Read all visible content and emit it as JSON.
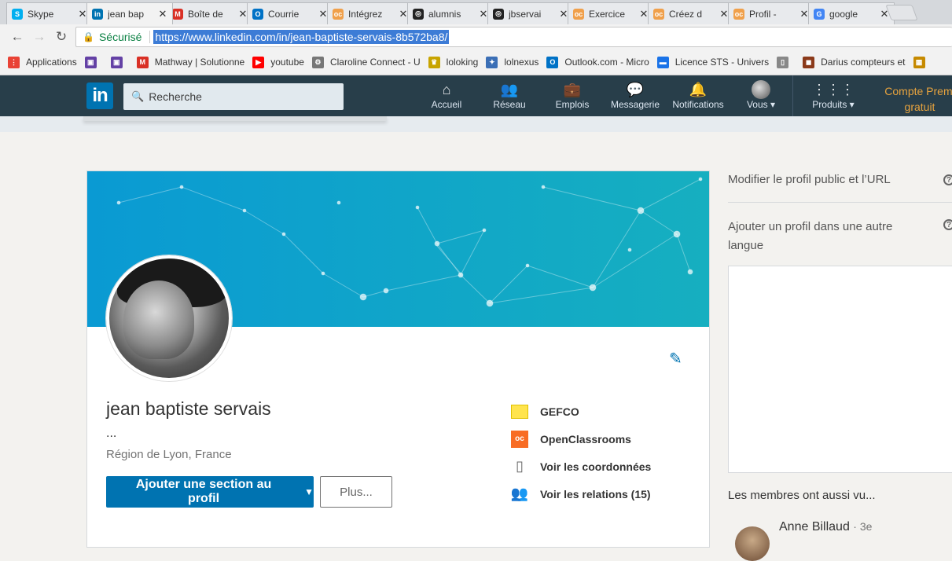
{
  "browser": {
    "tabs": [
      {
        "label": "Skype",
        "icon": "skype-icon",
        "color": "#00aff0",
        "glyph": "S",
        "active": false
      },
      {
        "label": "jean bap",
        "icon": "linkedin-icon",
        "color": "#0073b1",
        "glyph": "in",
        "active": true
      },
      {
        "label": "Boîte de",
        "icon": "gmail-icon",
        "color": "#d93025",
        "glyph": "M",
        "active": false
      },
      {
        "label": "Courrie",
        "icon": "outlook-icon",
        "color": "#0072c6",
        "glyph": "O",
        "active": false
      },
      {
        "label": "Intégrez",
        "icon": "openclassrooms-icon",
        "color": "#f0a04b",
        "glyph": "oc",
        "active": false
      },
      {
        "label": "alumnis",
        "icon": "github-icon",
        "color": "#222222",
        "glyph": "◎",
        "active": false
      },
      {
        "label": "jbservai",
        "icon": "github-icon",
        "color": "#222222",
        "glyph": "◎",
        "active": false
      },
      {
        "label": "Exercice",
        "icon": "openclassrooms-icon",
        "color": "#f0a04b",
        "glyph": "oc",
        "active": false
      },
      {
        "label": "Créez d",
        "icon": "openclassrooms-icon",
        "color": "#f0a04b",
        "glyph": "oc",
        "active": false
      },
      {
        "label": "Profil - ",
        "icon": "openclassrooms-icon",
        "color": "#f0a04b",
        "glyph": "oc",
        "active": false
      },
      {
        "label": "google",
        "icon": "google-icon",
        "color": "#4285f4",
        "glyph": "G",
        "active": false
      }
    ],
    "close_glyph": "✕",
    "nav": {
      "back": "←",
      "forward": "→",
      "reload": "↻"
    },
    "address": {
      "lock_glyph": "🔒",
      "secure_label": "Sécurisé",
      "url": "https://www.linkedin.com/in/jean-baptiste-servais-8b572ba8/"
    },
    "bookmarks": [
      {
        "label": "Applications",
        "icon": "apps-grid-icon",
        "color": "#e94235",
        "glyph": "⋮"
      },
      {
        "label": "",
        "icon": "twitch-icon",
        "color": "#6441a5",
        "glyph": "▣"
      },
      {
        "label": "",
        "icon": "twitch-icon",
        "color": "#6441a5",
        "glyph": "▣"
      },
      {
        "label": "Mathway | Solutionne",
        "icon": "mathway-icon",
        "color": "#d93025",
        "glyph": "M"
      },
      {
        "label": "youtube",
        "icon": "youtube-icon",
        "color": "#ff0000",
        "glyph": "▶"
      },
      {
        "label": "Claroline Connect - U",
        "icon": "claroline-icon",
        "color": "#777777",
        "glyph": "⚙"
      },
      {
        "label": "loloking",
        "icon": "loloking-icon",
        "color": "#c8a400",
        "glyph": "♛"
      },
      {
        "label": "lolnexus",
        "icon": "lolnexus-icon",
        "color": "#3b6fb6",
        "glyph": "✦"
      },
      {
        "label": "Outlook.com - Micro",
        "icon": "outlook-icon",
        "color": "#0072c6",
        "glyph": "O"
      },
      {
        "label": "Licence STS - Univers",
        "icon": "folder-icon",
        "color": "#1a73e8",
        "glyph": "▬"
      },
      {
        "label": "",
        "icon": "page-icon",
        "color": "#888888",
        "glyph": "▯"
      },
      {
        "label": "Darius compteurs et",
        "icon": "darius-icon",
        "color": "#8b3a1a",
        "glyph": "◼"
      },
      {
        "label": "",
        "icon": "bookmark-app-icon",
        "color": "#c68a00",
        "glyph": "▦"
      }
    ]
  },
  "linkedin_nav": {
    "logo": "in",
    "search_placeholder": "Recherche",
    "search_glyph": "🔍",
    "items": [
      {
        "label": "Accueil",
        "icon": "home-icon",
        "glyph": "⌂"
      },
      {
        "label": "Réseau",
        "icon": "network-icon",
        "glyph": "👥"
      },
      {
        "label": "Emplois",
        "icon": "jobs-icon",
        "glyph": "💼"
      },
      {
        "label": "Messagerie",
        "icon": "messaging-icon",
        "glyph": "💬"
      },
      {
        "label": "Notifications",
        "icon": "notifications-icon",
        "glyph": "🔔"
      },
      {
        "label": "Vous ▾",
        "icon": "avatar-icon",
        "glyph": ""
      },
      {
        "label": "Produits ▾",
        "icon": "products-grid-icon",
        "glyph": "⋮⋮⋮"
      }
    ],
    "premium_line1": "Compte Premi",
    "premium_line2": "gratuit"
  },
  "profile": {
    "name": "jean baptiste servais",
    "headline": "...",
    "location": "Région de Lyon, France",
    "edit_glyph": "✎",
    "primary_button": "Ajouter une section au profil",
    "primary_caret": "▼",
    "more_button": "Plus...",
    "side_items": [
      {
        "label": "GEFCO",
        "icon": "gefco-logo-icon",
        "kind": "gefco",
        "bold": true
      },
      {
        "label": "OpenClassrooms",
        "icon": "openclassrooms-logo-icon",
        "kind": "oc",
        "bold": true
      },
      {
        "label": "Voir les coordonnées",
        "icon": "contact-card-icon",
        "kind": "glyph",
        "glyph": "▯",
        "bold": true
      },
      {
        "label": "Voir les relations (15)",
        "icon": "connections-icon",
        "kind": "glyph",
        "glyph": "👥",
        "bold": true
      }
    ]
  },
  "right_rail": {
    "edit_public_profile": "Modifier le profil public et l’URL",
    "add_language_profile": "Ajouter un profil dans une autre langue",
    "help_glyph": "?",
    "also_viewed_title": "Les membres ont aussi vu...",
    "members": [
      {
        "name": "Anne Billaud",
        "degree": "· 3e"
      }
    ]
  },
  "colors": {
    "linkedin_blue": "#0073b1",
    "nav_dark": "#283e4a",
    "premium_gold": "#e7a33e",
    "secure_green": "#0b8043"
  }
}
